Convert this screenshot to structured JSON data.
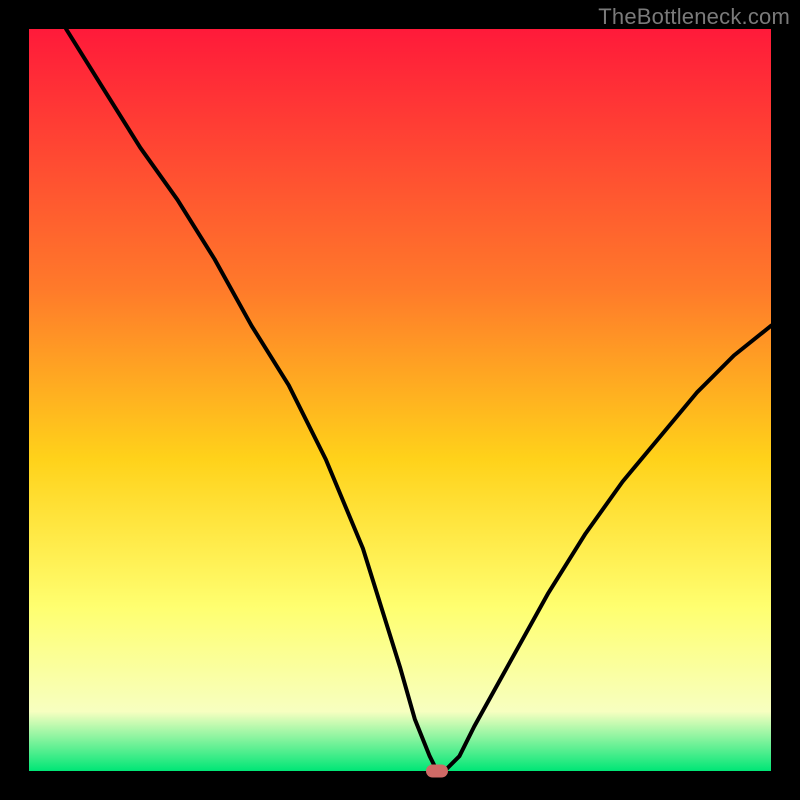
{
  "watermark": "TheBottleneck.com",
  "colors": {
    "bg": "#000000",
    "grad_top": "#ff1a3a",
    "grad_mid1": "#ff7a2a",
    "grad_mid2": "#ffd21a",
    "grad_mid3": "#ffff70",
    "grad_mid4": "#f7ffc0",
    "grad_bottom": "#00e676",
    "curve": "#000000",
    "marker": "#cf6a66"
  },
  "chart_data": {
    "type": "line",
    "title": "",
    "xlabel": "",
    "ylabel": "",
    "xlim": [
      0,
      100
    ],
    "ylim": [
      0,
      100
    ],
    "grid": false,
    "legend_position": "none",
    "series": [
      {
        "name": "bottleneck-curve",
        "x": [
          5,
          10,
          15,
          20,
          25,
          30,
          35,
          40,
          45,
          50,
          52,
          54,
          55,
          56,
          58,
          60,
          65,
          70,
          75,
          80,
          85,
          90,
          95,
          100
        ],
        "values": [
          100,
          92,
          84,
          77,
          69,
          60,
          52,
          42,
          30,
          14,
          7,
          2,
          0,
          0,
          2,
          6,
          15,
          24,
          32,
          39,
          45,
          51,
          56,
          60
        ]
      }
    ],
    "annotations": [
      {
        "name": "optimal-marker",
        "x": 55,
        "y": 0
      }
    ]
  }
}
